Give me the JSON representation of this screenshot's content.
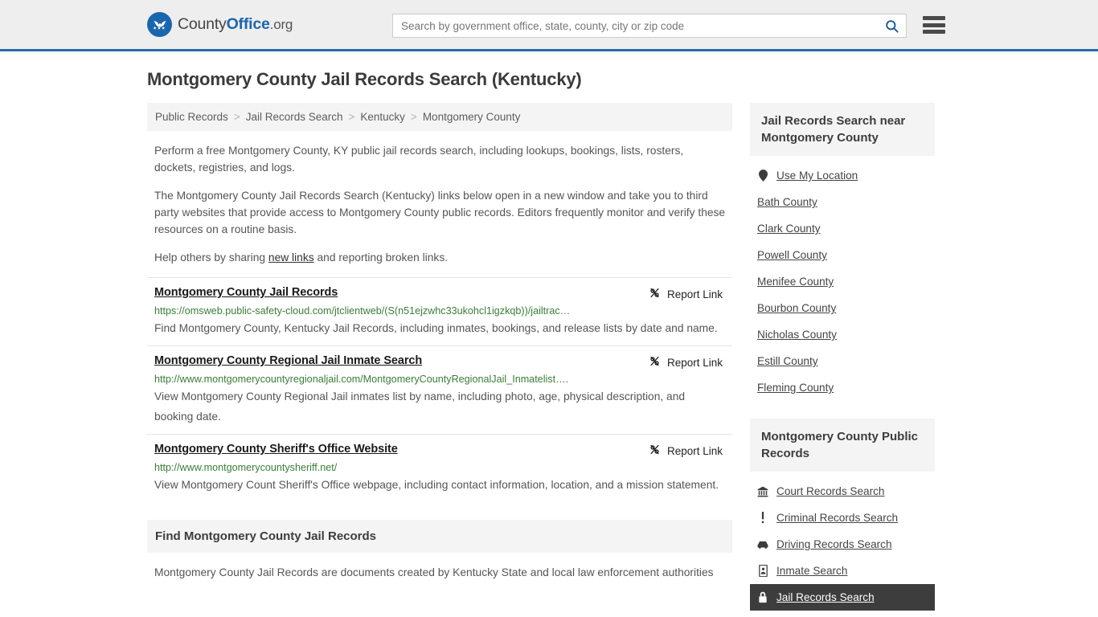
{
  "header": {
    "brand": {
      "part1": "County",
      "part2": "Office",
      "part3": ".org",
      "logo_icon": "eagle-shield-icon"
    },
    "search": {
      "placeholder": "Search by government office, state, county, city or zip code",
      "value": "",
      "search_icon": "search-icon"
    },
    "menu_icon": "hamburger-menu-icon",
    "accent_color": "#2a6ca6"
  },
  "main": {
    "title": "Montgomery County Jail Records Search (Kentucky)",
    "breadcrumb": [
      {
        "label": "Public Records"
      },
      {
        "label": "Jail Records Search"
      },
      {
        "label": "Kentucky"
      },
      {
        "label": "Montgomery County"
      }
    ],
    "breadcrumb_separator": ">",
    "paragraphs": {
      "p1": "Perform a free Montgomery County, KY public jail records search, including lookups, bookings, lists, rosters, dockets, registries, and logs.",
      "p2": "The Montgomery County Jail Records Search (Kentucky) links below open in a new window and take you to third party websites that provide access to Montgomery County public records. Editors frequently monitor and verify these resources on a routine basis.",
      "p3_before": "Help others by sharing ",
      "p3_link": "new links",
      "p3_after": " and reporting broken links."
    },
    "report_link_label": "Report Link",
    "report_link_icon": "broken-link-icon",
    "results": [
      {
        "title": "Montgomery County Jail Records",
        "url": "https://omsweb.public-safety-cloud.com/jtclientweb/(S(n51ejzwhc33ukohcl1igzkqb))/jailtrac…",
        "description": "Find Montgomery County, Kentucky Jail Records, including inmates, bookings, and release lists by date and name."
      },
      {
        "title": "Montgomery County Regional Jail Inmate Search",
        "url": "http://www.montgomerycountyregionaljail.com/MontgomeryCountyRegionalJail_Inmatelist….",
        "description": "View Montgomery County Regional Jail inmates list by name, including photo, age, physical description, and booking date."
      },
      {
        "title": "Montgomery County Sheriff's Office Website",
        "url": "http://www.montgomerycountysheriff.net/",
        "description": "View Montgomery Count Sheriff's Office webpage, including contact information, location, and a mission statement."
      }
    ],
    "find_section": {
      "heading": "Find Montgomery County Jail Records",
      "body": "Montgomery County Jail Records are documents created by Kentucky State and local law enforcement authorities"
    }
  },
  "sidebar": {
    "nearby": {
      "heading": "Jail Records Search near Montgomery County",
      "use_location": {
        "label": "Use My Location",
        "icon": "map-pin-icon"
      },
      "counties": [
        {
          "label": "Bath County"
        },
        {
          "label": "Clark County"
        },
        {
          "label": "Powell County"
        },
        {
          "label": "Menifee County"
        },
        {
          "label": "Bourbon County"
        },
        {
          "label": "Nicholas County"
        },
        {
          "label": "Estill County"
        },
        {
          "label": "Fleming County"
        }
      ]
    },
    "public_records": {
      "heading": "Montgomery County Public Records",
      "items": [
        {
          "label": "Court Records Search",
          "icon": "bank-icon",
          "active": false
        },
        {
          "label": "Criminal Records Search",
          "icon": "exclamation-icon",
          "active": false
        },
        {
          "label": "Driving Records Search",
          "icon": "car-icon",
          "active": false
        },
        {
          "label": "Inmate Search",
          "icon": "id-card-icon",
          "active": false
        },
        {
          "label": "Jail Records Search",
          "icon": "lock-icon",
          "active": true
        }
      ]
    }
  }
}
